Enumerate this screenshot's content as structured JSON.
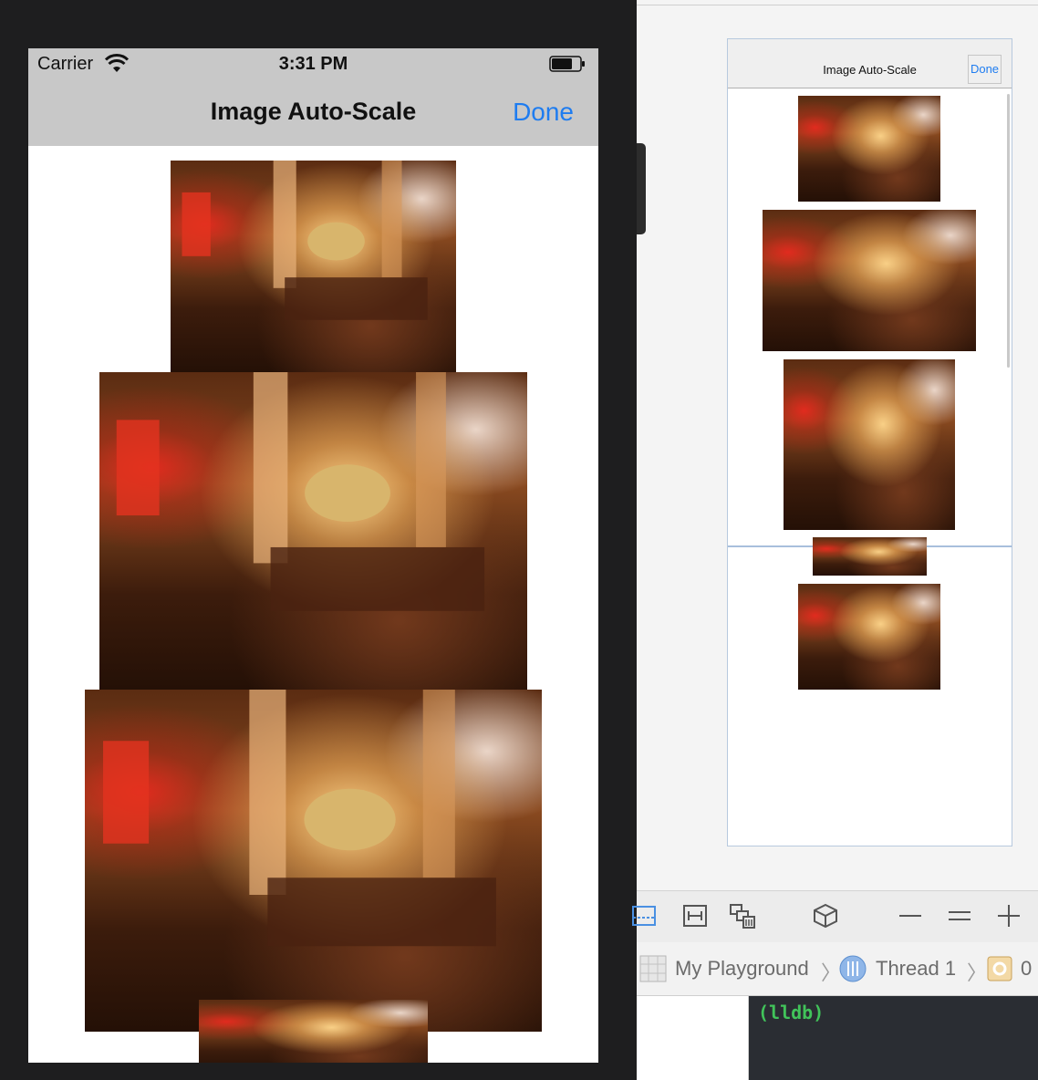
{
  "simulator": {
    "status_bar": {
      "carrier": "Carrier",
      "time": "3:31 PM"
    },
    "nav_bar": {
      "title": "Image Auto-Scale",
      "done_label": "Done"
    }
  },
  "playground_live_view": {
    "nav_bar": {
      "title": "Image Auto-Scale",
      "done_label": "Done"
    }
  },
  "debug_bar": {
    "icons": [
      "debug-area-icon",
      "layout-icon",
      "memory-graph-icon",
      "3d-view-icon",
      "zoom-out-icon",
      "actual-size-icon",
      "zoom-in-icon"
    ]
  },
  "breadcrumb": {
    "playground": "My Playground",
    "thread": "Thread 1",
    "frame": "0"
  },
  "console": {
    "prompt": "(lldb)"
  },
  "colors": {
    "accent": "#1e7cf0",
    "console_bg": "#2a2d33",
    "console_text": "#41c35a"
  }
}
